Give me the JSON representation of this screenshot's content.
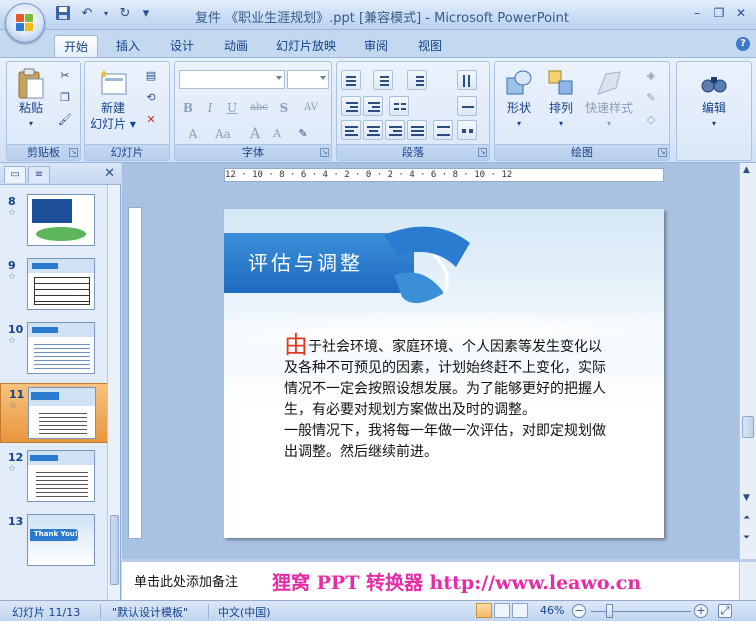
{
  "window": {
    "title": "复件 《职业生涯规划》.ppt [兼容模式] - Microsoft PowerPoint"
  },
  "quick_access": {
    "save": "save-icon",
    "undo": "undo-icon",
    "redo": "redo-icon",
    "customize": "▾"
  },
  "tabs": [
    {
      "label": "开始",
      "active": true
    },
    {
      "label": "插入"
    },
    {
      "label": "设计"
    },
    {
      "label": "动画"
    },
    {
      "label": "幻灯片放映"
    },
    {
      "label": "审阅"
    },
    {
      "label": "视图"
    }
  ],
  "ribbon": {
    "clipboard": {
      "label": "剪贴板",
      "paste": "粘贴"
    },
    "slides": {
      "label": "幻灯片",
      "new_slide_line1": "新建",
      "new_slide_line2": "幻灯片 ▾"
    },
    "font": {
      "label": "字体",
      "buttons": [
        "B",
        "I",
        "U",
        "abc",
        "S",
        "AV",
        "A",
        "Aa",
        "A",
        "A"
      ]
    },
    "paragraph": {
      "label": "段落"
    },
    "drawing": {
      "label": "绘图",
      "shapes": "形状",
      "arrange": "排列",
      "quick_styles": "快速样式"
    },
    "editing": {
      "label": "编辑"
    }
  },
  "slides_pane": {
    "thumbnails": [
      {
        "number": "8"
      },
      {
        "number": "9"
      },
      {
        "number": "10"
      },
      {
        "number": "11",
        "selected": true
      },
      {
        "number": "12"
      },
      {
        "number": "13",
        "text": "Thank You!"
      }
    ]
  },
  "ruler": {
    "horizontal": "12 · 10 · 8 · 6 · 4 · 2 · 0 · 2 · 4 · 6 · 8 · 10 · 12"
  },
  "slide": {
    "title": "评估与调整",
    "drop_cap": "由",
    "paragraph1": "于社会环境、家庭环境、个人因素等发生变化以及各种不可预见的因素，计划始终赶不上变化，实际情况不一定会按照设想发展。为了能够更好的把握人生，有必要对规划方案做出及时的调整。",
    "paragraph2": "一般情况下，我将每一年做一次评估，对即定规划做出调整。然后继续前进。"
  },
  "notes": {
    "placeholder": "单击此处添加备注",
    "watermark": "狸窝 PPT 转换器 http://www.leawo.cn"
  },
  "status": {
    "slide_counter": "幻灯片 11/13",
    "theme": "\"默认设计模板\"",
    "language": "中文(中国)",
    "zoom": "46%"
  },
  "colors": {
    "accent": "#3b8fd8",
    "ribbon_bg": "#dbe8f8",
    "selected_thumb": "#f4b85f",
    "watermark": "#e62ba6"
  }
}
